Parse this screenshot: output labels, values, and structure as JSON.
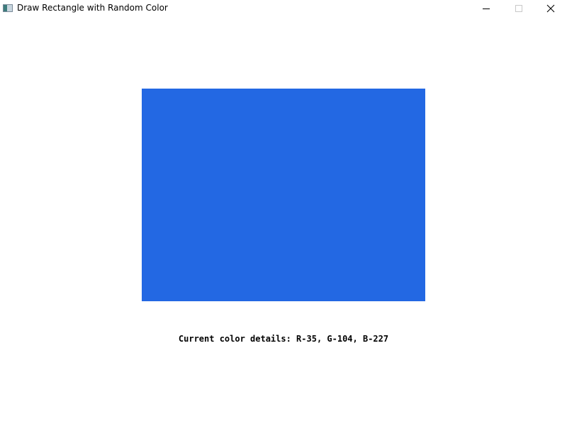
{
  "window": {
    "title": "Draw Rectangle with Random Color"
  },
  "icons": {
    "app": "app-window-icon",
    "minimize": "minimize-icon",
    "maximize": "maximize-icon",
    "close": "close-icon"
  },
  "rectangle": {
    "color": "#2368E3",
    "r": 35,
    "g": 104,
    "b": 227
  },
  "details": {
    "text": "Current color details: R-35, G-104, B-227"
  }
}
